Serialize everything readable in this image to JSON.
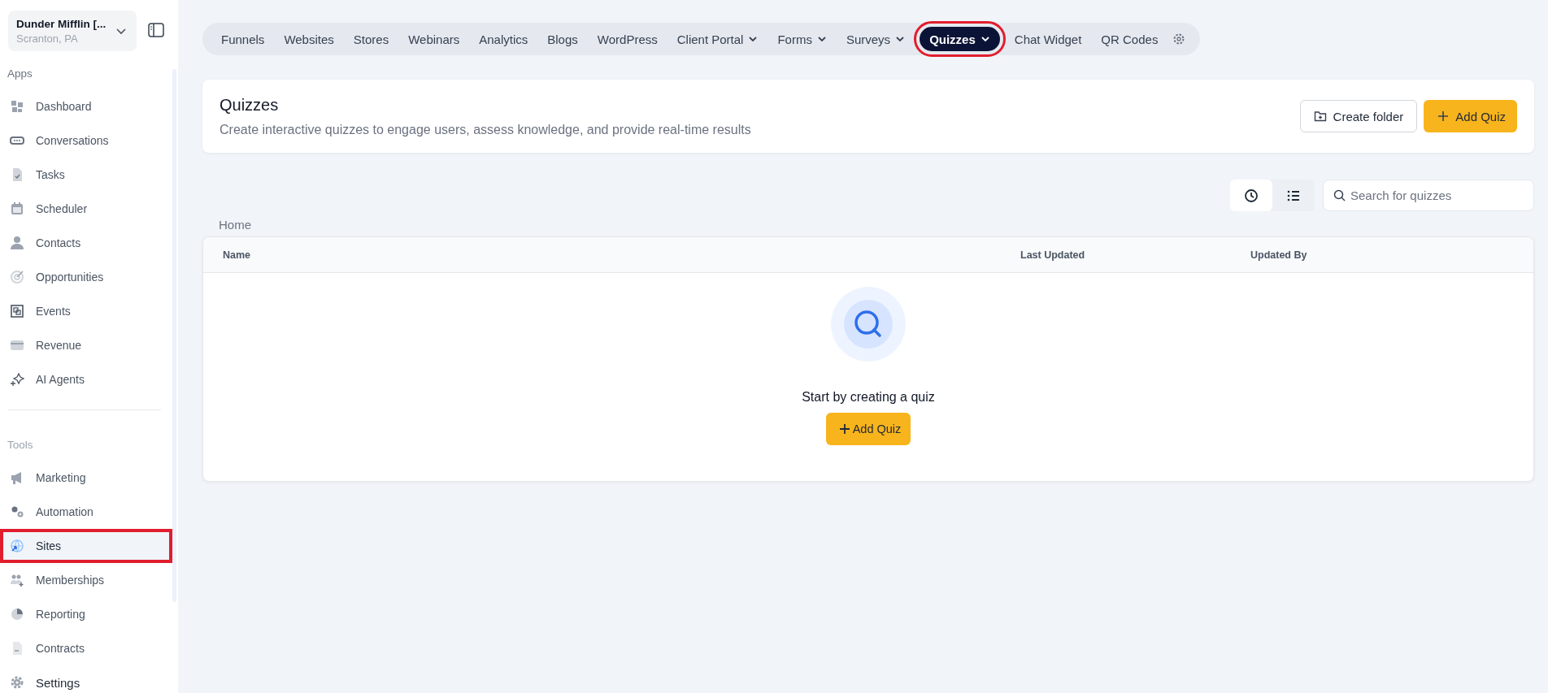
{
  "account": {
    "name": "Dunder Mifflin [...",
    "location": "Scranton, PA"
  },
  "sidebar": {
    "sections": [
      {
        "title": "Apps",
        "items": [
          {
            "label": "Dashboard",
            "selected": false,
            "highlighted": false
          },
          {
            "label": "Conversations",
            "selected": false,
            "highlighted": false
          },
          {
            "label": "Tasks",
            "selected": false,
            "highlighted": false
          },
          {
            "label": "Scheduler",
            "selected": false,
            "highlighted": false
          },
          {
            "label": "Contacts",
            "selected": false,
            "highlighted": false
          },
          {
            "label": "Opportunities",
            "selected": false,
            "highlighted": false
          },
          {
            "label": "Events",
            "selected": false,
            "highlighted": false
          },
          {
            "label": "Revenue",
            "selected": false,
            "highlighted": false
          },
          {
            "label": "AI Agents",
            "selected": false,
            "highlighted": false
          }
        ]
      },
      {
        "title": "Tools",
        "items": [
          {
            "label": "Marketing",
            "selected": false,
            "highlighted": false
          },
          {
            "label": "Automation",
            "selected": false,
            "highlighted": false
          },
          {
            "label": "Sites",
            "selected": true,
            "highlighted": true
          },
          {
            "label": "Memberships",
            "selected": false,
            "highlighted": false
          },
          {
            "label": "Reporting",
            "selected": false,
            "highlighted": false
          },
          {
            "label": "Contracts",
            "selected": false,
            "highlighted": false
          },
          {
            "label": "Settings",
            "selected": false,
            "highlighted": false
          }
        ]
      }
    ]
  },
  "nav_tabs": [
    {
      "label": "Funnels",
      "dropdown": false,
      "selected": false,
      "highlighted": false
    },
    {
      "label": "Websites",
      "dropdown": false,
      "selected": false,
      "highlighted": false
    },
    {
      "label": "Stores",
      "dropdown": false,
      "selected": false,
      "highlighted": false
    },
    {
      "label": "Webinars",
      "dropdown": false,
      "selected": false,
      "highlighted": false
    },
    {
      "label": "Analytics",
      "dropdown": false,
      "selected": false,
      "highlighted": false
    },
    {
      "label": "Blogs",
      "dropdown": false,
      "selected": false,
      "highlighted": false
    },
    {
      "label": "WordPress",
      "dropdown": false,
      "selected": false,
      "highlighted": false
    },
    {
      "label": "Client Portal",
      "dropdown": true,
      "selected": false,
      "highlighted": false
    },
    {
      "label": "Forms",
      "dropdown": true,
      "selected": false,
      "highlighted": false
    },
    {
      "label": "Surveys",
      "dropdown": true,
      "selected": false,
      "highlighted": false
    },
    {
      "label": "Quizzes",
      "dropdown": true,
      "selected": true,
      "highlighted": true
    },
    {
      "label": "Chat Widget",
      "dropdown": false,
      "selected": false,
      "highlighted": false
    },
    {
      "label": "QR Codes",
      "dropdown": false,
      "selected": false,
      "highlighted": false
    }
  ],
  "header": {
    "title": "Quizzes",
    "subtitle": "Create interactive quizzes to engage users, assess knowledge, and provide real-time results",
    "buttons": [
      {
        "label": "Create folder",
        "kind": "secondary"
      },
      {
        "label": "Add Quiz",
        "kind": "primary"
      }
    ]
  },
  "view_toggle": [
    {
      "kind": "recent",
      "selected": true
    },
    {
      "kind": "list",
      "selected": false
    }
  ],
  "search": {
    "placeholder": "Search for quizzes"
  },
  "breadcrumb": "Home",
  "table": {
    "columns": [
      "Name",
      "Last Updated",
      "Updated By"
    ],
    "empty_state": {
      "message": "Start by creating a quiz",
      "button": "Add Quiz"
    }
  }
}
